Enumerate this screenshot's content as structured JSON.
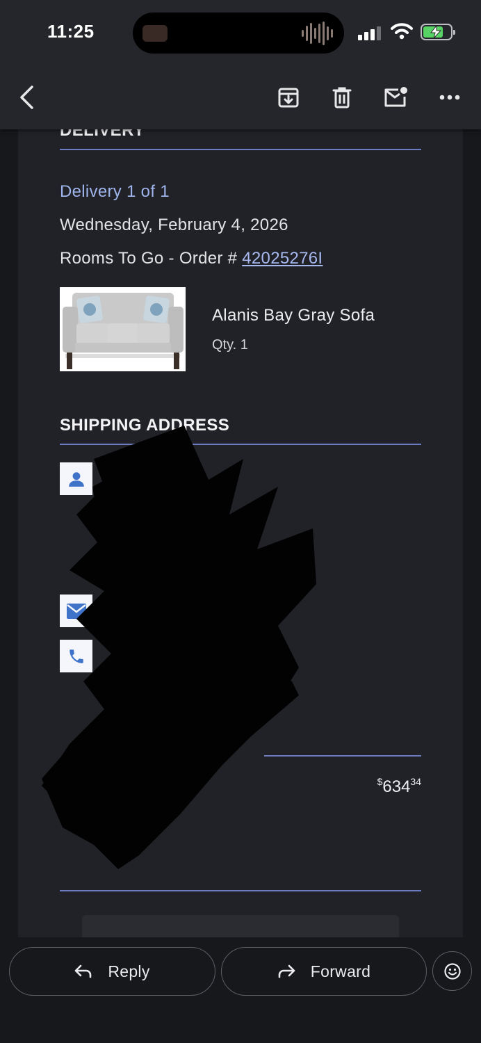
{
  "status_bar": {
    "time": "11:25"
  },
  "toolbar": {
    "back_icon": "chevron-left-icon",
    "archive_icon": "archive-icon",
    "delete_icon": "trash-icon",
    "unread_icon": "mark-unread-icon",
    "more_icon": "more-horizontal-icon"
  },
  "email": {
    "delivery_section_title": "DELIVERY",
    "delivery_count": "Delivery 1 of 1",
    "delivery_date": "Wednesday, February 4, 2026",
    "order_prefix": "Rooms To Go - Order # ",
    "order_number": "42025276I",
    "product": {
      "name": "Alanis Bay Gray Sofa",
      "quantity": "Qty. 1"
    },
    "shipping_section_title": "SHIPPING ADDRESS",
    "shipping_icons": [
      "person-icon",
      "mail-icon",
      "phone-icon"
    ],
    "price": {
      "currency": "$",
      "dollars": "634",
      "cents": "34"
    }
  },
  "actions": {
    "reply_label": "Reply",
    "forward_label": "Forward",
    "emoji_icon": "emoji-icon"
  },
  "colors": {
    "background": "#17181c",
    "card": "#212227",
    "rule": "#6f7bbf",
    "link": "#a8b9f0"
  }
}
